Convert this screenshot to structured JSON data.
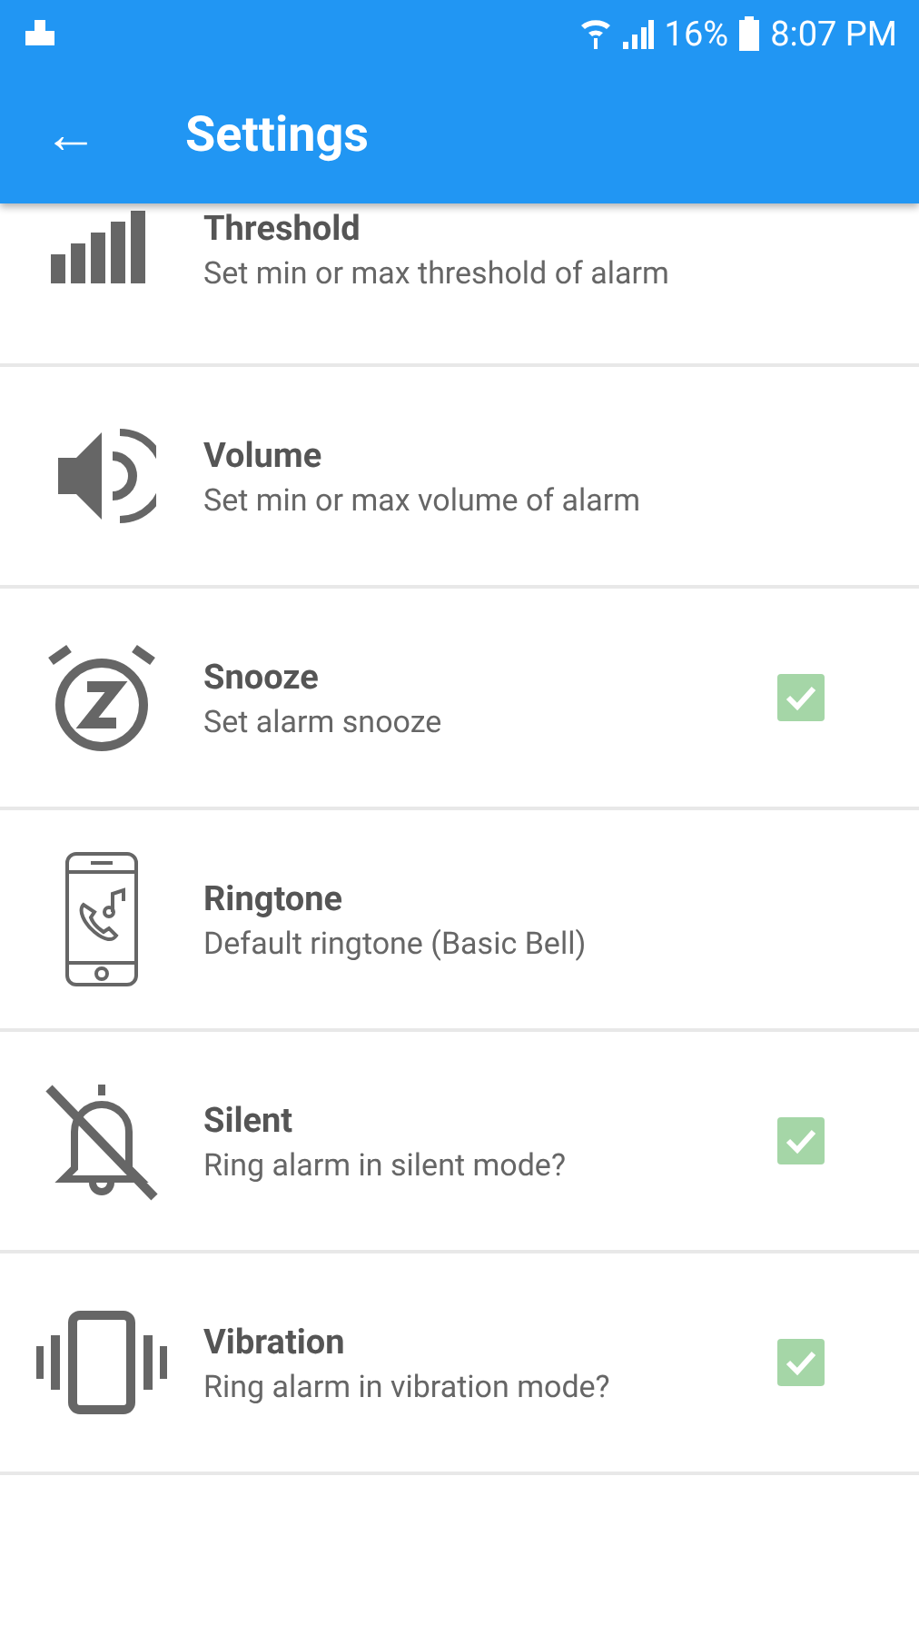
{
  "status_bar": {
    "battery": "16%",
    "time": "8:07 PM"
  },
  "app_bar": {
    "back": "←",
    "title": "Settings"
  },
  "settings": [
    {
      "title": "Threshold",
      "subtitle": "Set min or max threshold of alarm",
      "kind": "plain"
    },
    {
      "title": "Volume",
      "subtitle": "Set min or max volume of alarm",
      "kind": "plain"
    },
    {
      "title": "Snooze",
      "subtitle": "Set alarm snooze",
      "kind": "checkbox",
      "checked": true
    },
    {
      "title": "Ringtone",
      "subtitle": "Default ringtone (Basic Bell)",
      "kind": "plain"
    },
    {
      "title": "Silent",
      "subtitle": "Ring alarm in silent mode?",
      "kind": "checkbox",
      "checked": true
    },
    {
      "title": "Vibration",
      "subtitle": "Ring alarm in vibration mode?",
      "kind": "checkbox",
      "checked": true
    }
  ]
}
